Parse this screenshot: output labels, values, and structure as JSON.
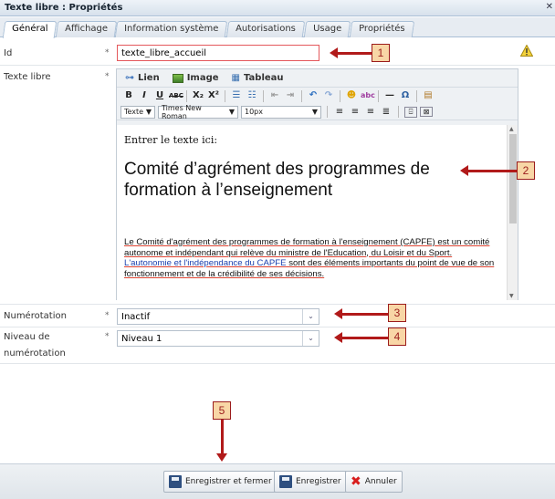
{
  "window": {
    "title": "Texte libre : Propriétés"
  },
  "tabs": [
    {
      "label": "Général"
    },
    {
      "label": "Affichage"
    },
    {
      "label": "Information système"
    },
    {
      "label": "Autorisations"
    },
    {
      "label": "Usage"
    },
    {
      "label": "Propriétés"
    }
  ],
  "form": {
    "required_mark": "*",
    "id": {
      "label": "Id",
      "value": "texte_libre_accueil"
    },
    "texte_libre": {
      "label": "Texte libre"
    },
    "numerotation": {
      "label": "Numérotation",
      "value": "Inactif"
    },
    "niveau": {
      "label_line1": "Niveau de",
      "label_line2": "numérotation",
      "value": "Niveau 1"
    }
  },
  "editor": {
    "toolbar1": {
      "link": "Lien",
      "image": "Image",
      "table": "Tableau"
    },
    "toolbar3": {
      "style": "Texte",
      "font": "Times New Roman",
      "size": "10px"
    },
    "content": {
      "intro": "Entrer le texte ici:",
      "heading": "Comité d’agrément des programmes de formation à l’enseignement",
      "para_part1": "Le Comité d'agrément des programmes de formation à l'enseignement (CAPFE) est un comité autonome et indépendant qui relève du ministre de l'Education, du Loisir et du Sport. ",
      "para_link": "L'autonomie et l'indépendance du CAPFE",
      "para_part2": " sont des éléments importants du point de vue de son fonctionnement et de la crédibilité de ses décisions."
    }
  },
  "buttons": {
    "save_close": "Enregistrer et fermer",
    "save": "Enregistrer",
    "cancel": "Annuler"
  },
  "callouts": [
    "1",
    "2",
    "3",
    "4",
    "5"
  ],
  "colors": {
    "callout_border": "#9b1c1c",
    "callout_fill": "#f8d6a6",
    "arrow": "#b11a1a",
    "required_border": "#e4585c"
  }
}
